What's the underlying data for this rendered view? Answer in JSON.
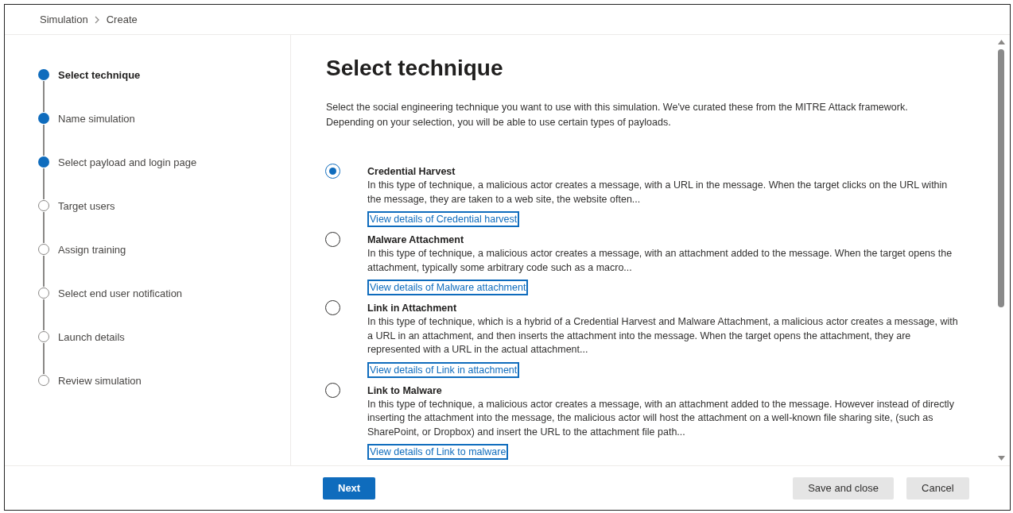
{
  "breadcrumb": [
    "Simulation",
    "Create"
  ],
  "steps": [
    {
      "label": "Select technique",
      "selected": true,
      "filled": true
    },
    {
      "label": "Name simulation",
      "selected": false,
      "filled": true
    },
    {
      "label": "Select payload and login page",
      "selected": false,
      "filled": true
    },
    {
      "label": "Target users",
      "selected": false,
      "filled": false
    },
    {
      "label": "Assign training",
      "selected": false,
      "filled": false
    },
    {
      "label": "Select end user notification",
      "selected": false,
      "filled": false
    },
    {
      "label": "Launch details",
      "selected": false,
      "filled": false
    },
    {
      "label": "Review simulation",
      "selected": false,
      "filled": false
    }
  ],
  "title": "Select technique",
  "description": "Select the social engineering technique you want to use with this simulation. We've curated these from the MITRE Attack framework. Depending on your selection, you will be able to use certain types of payloads.",
  "options": [
    {
      "title": "Credential Harvest",
      "selected": true,
      "text": "In this type of technique, a malicious actor creates a message, with a URL in the message. When the target clicks on the URL within the message, they are taken to a web site, the website often...",
      "link": "View details of Credential harvest"
    },
    {
      "title": "Malware Attachment",
      "selected": false,
      "text": "In this type of technique, a malicious actor creates a message, with an attachment added to the message. When the target opens the attachment, typically some arbitrary code such as a macro...",
      "link": "View details of Malware attachment"
    },
    {
      "title": "Link in Attachment",
      "selected": false,
      "text": "In this type of technique, which is a hybrid of a Credential Harvest and Malware Attachment, a malicious actor creates a message, with a URL in an attachment, and then inserts the attachment into the message. When the target opens the attachment, they are represented with a URL in the actual attachment...",
      "link": "View details of Link in attachment"
    },
    {
      "title": "Link to Malware",
      "selected": false,
      "text": "In this type of technique, a malicious actor creates a message, with an attachment added to the message. However instead of directly inserting the attachment into the message, the malicious actor will host the attachment on a well-known file sharing site, (such as SharePoint, or Dropbox) and insert the URL to the attachment file path...",
      "link": "View details of Link to malware"
    }
  ],
  "footer": {
    "next": "Next",
    "save": "Save and close",
    "cancel": "Cancel"
  }
}
